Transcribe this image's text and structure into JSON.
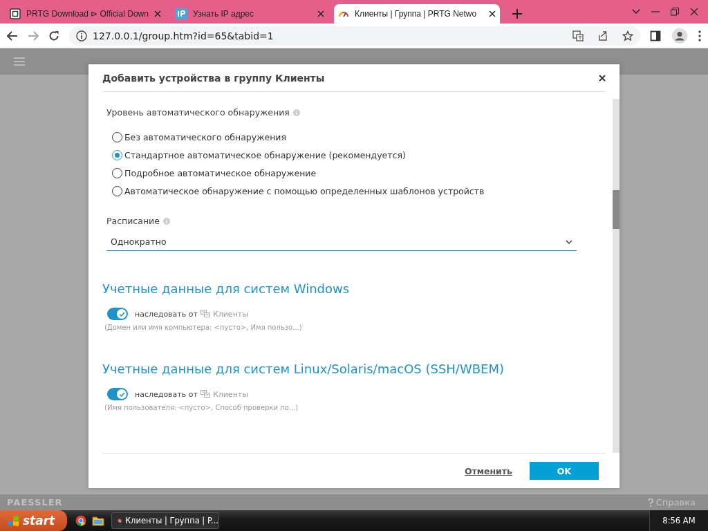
{
  "browser": {
    "tabs": [
      {
        "title": "PRTG Download ⊳ Official Down",
        "kind": "prtg",
        "selected": false
      },
      {
        "title": "Узнать IP адрес",
        "kind": "ip",
        "selected": false
      },
      {
        "title": "Клиенты | Группа | PRTG Netwo",
        "kind": "gauge",
        "selected": true
      }
    ],
    "url": "127.0.0.1/group.htm?id=65&tabid=1"
  },
  "page": {
    "footer_logo": "PAESSLER",
    "help_link": "Справка"
  },
  "dialog": {
    "title": "Добавить устройства в группу Клиенты",
    "discovery_level": {
      "label": "Уровень автоматического обнаружения",
      "options": [
        {
          "label": "Без автоматического обнаружения",
          "selected": false
        },
        {
          "label": "Стандартное автоматическое обнаружение (рекомендуется)",
          "selected": true
        },
        {
          "label": "Подробное автоматическое обнаружение",
          "selected": false
        },
        {
          "label": "Автоматическое обнаружение с помощью определенных шаблонов устройств",
          "selected": false
        }
      ]
    },
    "schedule": {
      "label": "Расписание",
      "value": "Однократно"
    },
    "credential_sections": [
      {
        "title": "Учетные данные для систем Windows",
        "inherit_on": true,
        "inherit_text": "наследовать от",
        "source": "Клиенты",
        "summary": "(Домен или имя компьютера: <пусто>, Имя пользо...)"
      },
      {
        "title": "Учетные данные для систем Linux/Solaris/macOS (SSH/WBEM)",
        "inherit_on": true,
        "inherit_text": "наследовать от",
        "source": "Клиенты",
        "summary": "(Имя пользователя: <пусто>, Способ проверки по...)"
      }
    ],
    "cancel_button": "Отменить",
    "ok_button": "OK"
  },
  "taskbar": {
    "start": "start",
    "windows": [
      {
        "title": "Клиенты | Группа | P...",
        "selected": true
      }
    ],
    "clock": "8:56 AM"
  }
}
